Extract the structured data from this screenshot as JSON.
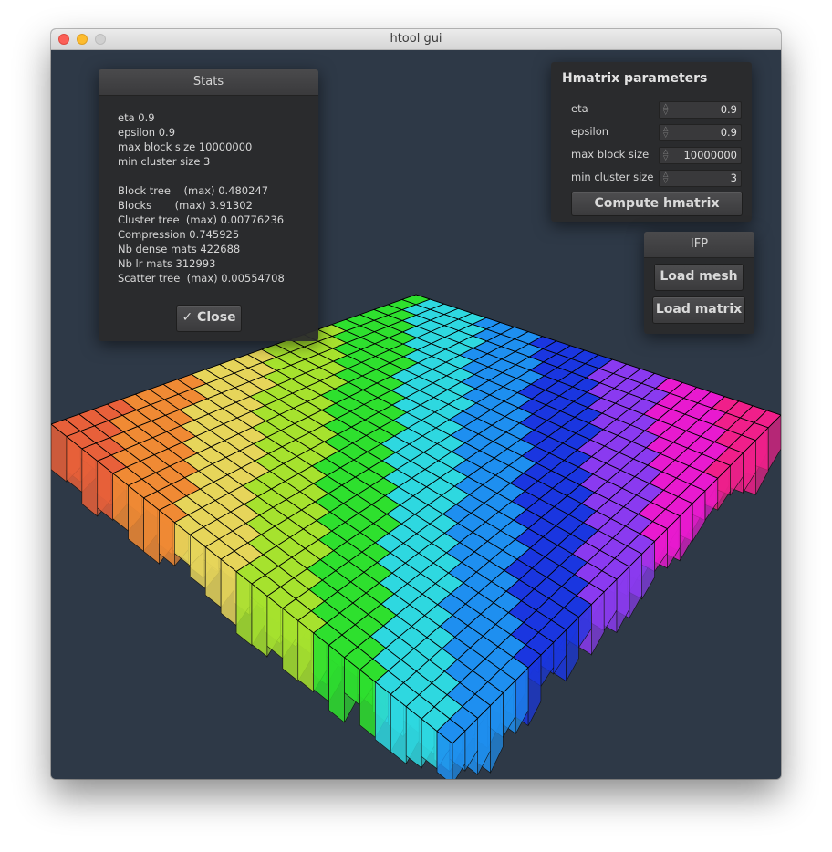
{
  "window": {
    "title": "htool gui"
  },
  "stats": {
    "header": "Stats",
    "params": [
      "eta 0.9",
      "epsilon 0.9",
      "max block size 10000000",
      "min cluster size 3"
    ],
    "timings": [
      "Block tree    (max) 0.480247",
      "Blocks       (max) 3.91302",
      "Cluster tree  (max) 0.00776236",
      "Compression 0.745925",
      "Nb dense mats 422688",
      "Nb lr mats 312993",
      "Scatter tree  (max) 0.00554708"
    ],
    "close_label": "✓ Close"
  },
  "hmatrix": {
    "title": "Hmatrix parameters",
    "fields": [
      {
        "label": "eta",
        "value": "0.9"
      },
      {
        "label": "epsilon",
        "value": "0.9"
      },
      {
        "label": "max block size",
        "value": "10000000"
      },
      {
        "label": "min cluster size",
        "value": "3"
      }
    ],
    "compute_label": "Compute hmatrix"
  },
  "ifp": {
    "header": "IFP",
    "load_mesh_label": "Load mesh",
    "load_matrix_label": "Load matrix"
  },
  "scene": {
    "background": "#2e3947",
    "colors": [
      "#e8603a",
      "#f08a34",
      "#e6d55a",
      "#a6e22e",
      "#2ee02e",
      "#2ed8e0",
      "#1e8ff0",
      "#1a36e0",
      "#8a3af0",
      "#e81acf",
      "#f01f8a"
    ]
  }
}
